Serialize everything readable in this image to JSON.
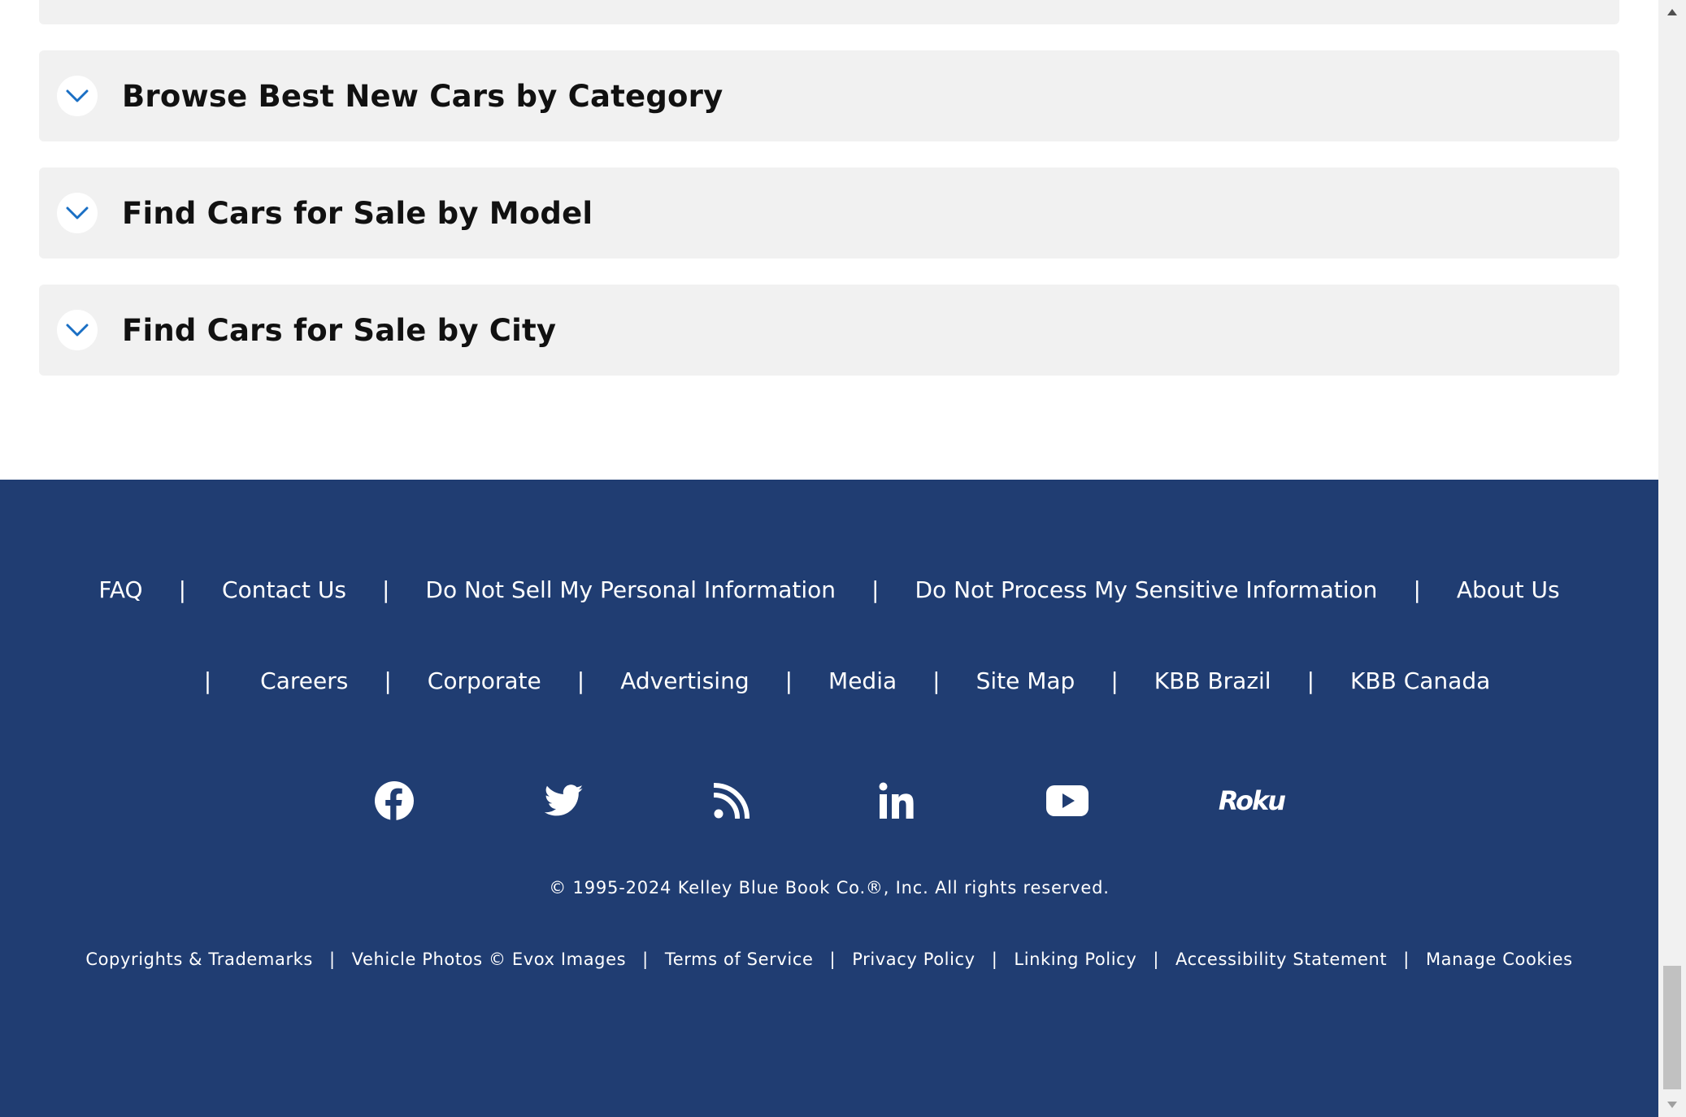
{
  "accordion": {
    "sections": [
      {
        "label": "Browse Best New Cars by Category"
      },
      {
        "label": "Find Cars for Sale by Model"
      },
      {
        "label": "Find Cars for Sale by City"
      }
    ]
  },
  "footer": {
    "nav_row1": [
      "FAQ",
      "Contact Us",
      "Do Not Sell My Personal Information",
      "Do Not Process My Sensitive Information",
      "About Us"
    ],
    "nav_row2": [
      "Careers",
      "Corporate",
      "Advertising",
      "Media",
      "Site Map",
      "KBB Brazil",
      "KBB Canada"
    ],
    "separator": "|",
    "social": [
      {
        "name": "facebook-icon"
      },
      {
        "name": "twitter-icon"
      },
      {
        "name": "rss-icon"
      },
      {
        "name": "linkedin-icon"
      },
      {
        "name": "youtube-icon"
      },
      {
        "name": "roku-icon",
        "text": "Roku"
      }
    ],
    "copyright": "© 1995-2024 Kelley Blue Book Co.®, Inc. All rights reserved.",
    "legal_links": [
      "Copyrights & Trademarks",
      "Vehicle Photos © Evox Images",
      "Terms of Service",
      "Privacy Policy",
      "Linking Policy",
      "Accessibility Statement",
      "Manage Cookies"
    ]
  },
  "colors": {
    "footer_bg": "#203d72",
    "accordion_bg": "#f1f1f1",
    "chevron": "#1a6fc4"
  }
}
